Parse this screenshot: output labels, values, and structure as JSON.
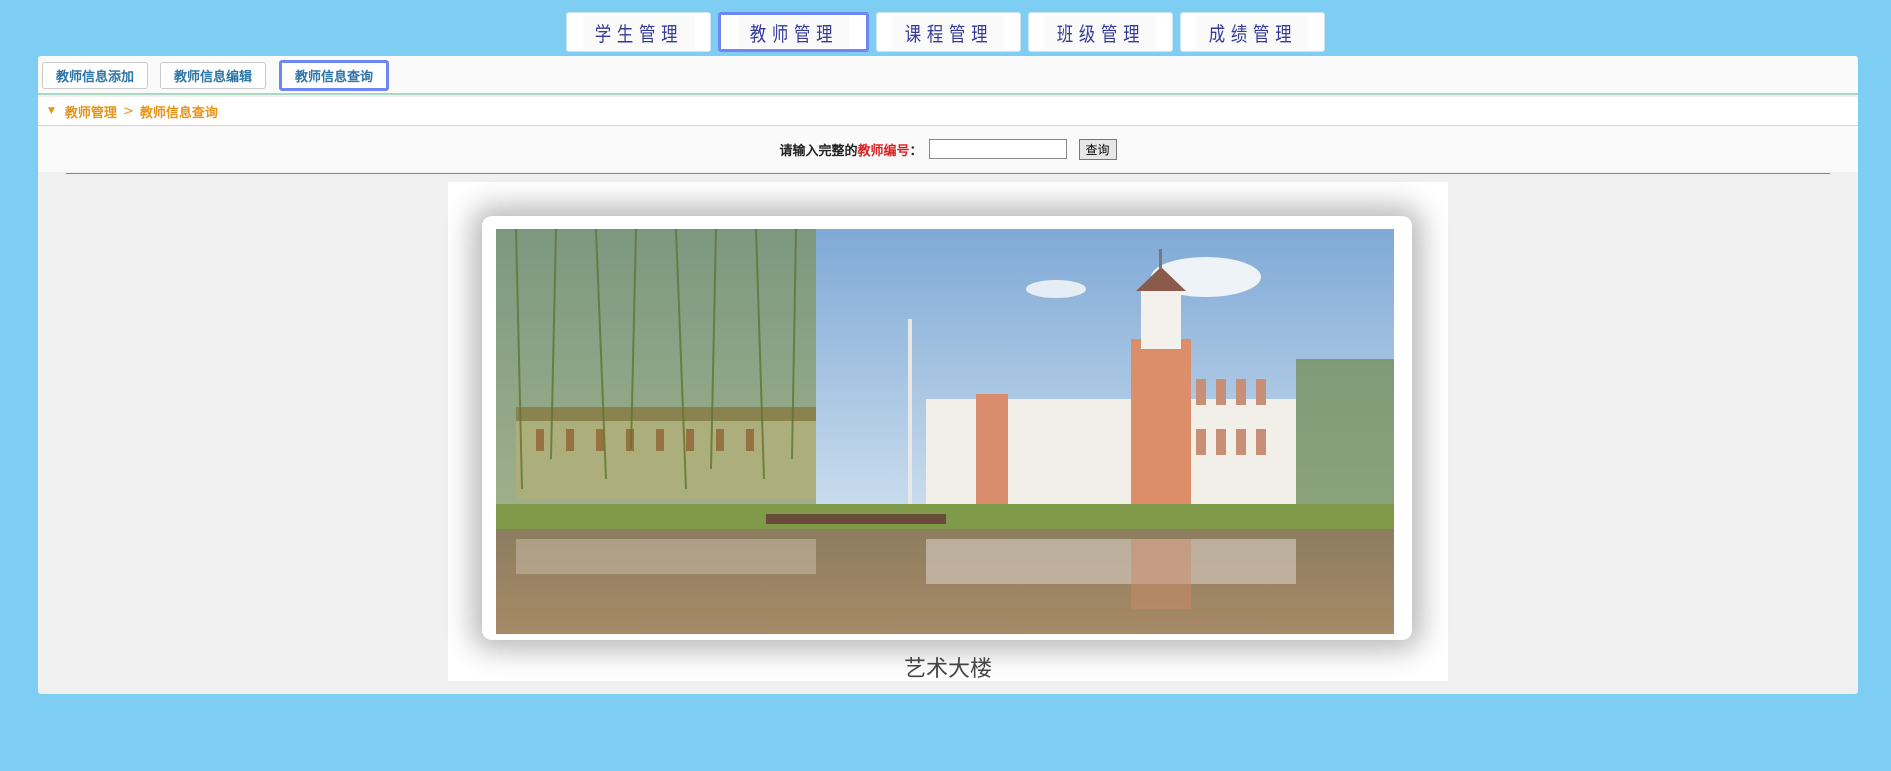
{
  "top_nav": {
    "tabs": [
      {
        "label": "学生管理",
        "active": false
      },
      {
        "label": "教师管理",
        "active": true
      },
      {
        "label": "课程管理",
        "active": false
      },
      {
        "label": "班级管理",
        "active": false
      },
      {
        "label": "成绩管理",
        "active": false
      }
    ]
  },
  "sub_nav": {
    "buttons": [
      {
        "label": "教师信息添加"
      },
      {
        "label": "教师信息编辑"
      },
      {
        "label": "教师信息查询",
        "active": true
      }
    ]
  },
  "breadcrumb": {
    "parent": "教师管理",
    "separator": ">",
    "current": "教师信息查询"
  },
  "search": {
    "prefix": "请输入完整的",
    "highlight": "教师编号",
    "suffix": "：",
    "input_value": "",
    "button_label": "查询"
  },
  "photo": {
    "caption": "艺术大楼"
  },
  "colors": {
    "background": "#7ecef4",
    "accent_border": "#6f86f5",
    "breadcrumb_text": "#e8941a",
    "highlight_red": "#e02020"
  }
}
